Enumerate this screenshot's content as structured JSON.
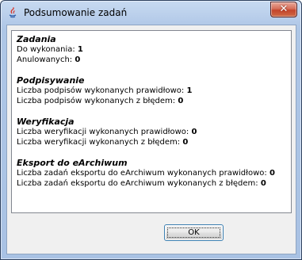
{
  "window": {
    "title": "Podsumowanie zadań",
    "close_symbol": "✕",
    "icon": "java-app-icon"
  },
  "sections": [
    {
      "heading": "Zadania",
      "rows": [
        {
          "label": "Do wykonania: ",
          "value": "1"
        },
        {
          "label": "Anulowanych: ",
          "value": "0"
        }
      ]
    },
    {
      "heading": "Podpisywanie",
      "rows": [
        {
          "label": "Liczba podpisów wykonanych prawidłowo: ",
          "value": "1"
        },
        {
          "label": "Liczba podpisów wykonanych z błędem: ",
          "value": "0"
        }
      ]
    },
    {
      "heading": "Weryfikacja",
      "rows": [
        {
          "label": "Liczba weryfikacji wykonanych prawidłowo: ",
          "value": "0"
        },
        {
          "label": "Liczba weryfikacji wykonanych z błędem: ",
          "value": "0"
        }
      ]
    },
    {
      "heading": "Eksport do eArchiwum",
      "rows": [
        {
          "label": "Liczba zadań eksportu do eArchiwum wykonanych prawidłowo: ",
          "value": "0"
        },
        {
          "label": "Liczba zadań eksportu do eArchiwum wykonanych z błędem: ",
          "value": "0"
        }
      ]
    }
  ],
  "buttons": {
    "ok_label": "OK"
  }
}
